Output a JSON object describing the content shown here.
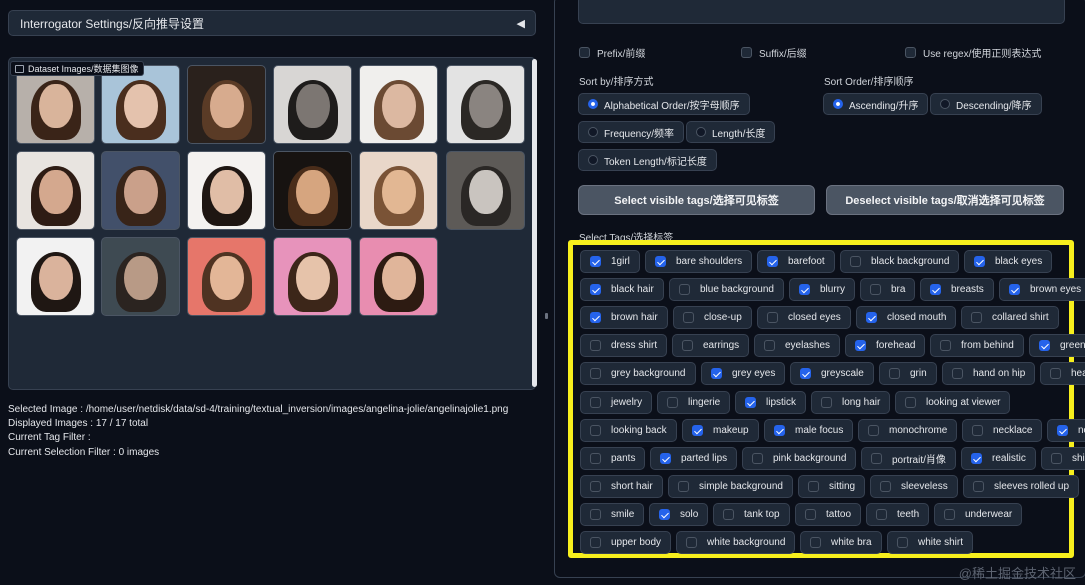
{
  "accordion": {
    "title": "Interrogator Settings/反向推导设置",
    "arrow": "◀"
  },
  "gallery": {
    "label": "Dataset Images/数据集图像",
    "thumbnails": [
      {
        "bg": "#b7b0aa",
        "skin": "#d9b49b",
        "hair": "#3a2418"
      },
      {
        "bg": "#a9c4d9",
        "skin": "#e4c2ad",
        "hair": "#4a2e1e"
      },
      {
        "bg": "#2a211c",
        "skin": "#d7ab8e",
        "hair": "#5a3b26"
      },
      {
        "bg": "#d8d6d4",
        "skin": "#7c7672",
        "hair": "#1e1c1b"
      },
      {
        "bg": "#f0efed",
        "skin": "#dcb8a1",
        "hair": "#6b4a33"
      },
      {
        "bg": "#e3e3e3",
        "skin": "#8a8480",
        "hair": "#2b2825"
      },
      {
        "bg": "#e8e4e0",
        "skin": "#d4a88e",
        "hair": "#2e1c14"
      },
      {
        "bg": "#42506a",
        "skin": "#caa08a",
        "hair": "#382418"
      },
      {
        "bg": "#f4f2f0",
        "skin": "#e0bda6",
        "hair": "#1e1612"
      },
      {
        "bg": "#171311",
        "skin": "#d6a57f",
        "hair": "#4a2d1a"
      },
      {
        "bg": "#e9d7c9",
        "skin": "#e2b793",
        "hair": "#7a5336"
      },
      {
        "bg": "#5d5a57",
        "skin": "#c9c4bf",
        "hair": "#2a2725"
      },
      {
        "bg": "#f2f2f2",
        "skin": "#dab39c",
        "hair": "#1f1713"
      },
      {
        "bg": "#3e4a52",
        "skin": "#b89a86",
        "hair": "#2b2420"
      },
      {
        "bg": "#e6766a",
        "skin": "#e3b697",
        "hair": "#4f3322"
      },
      {
        "bg": "#e793bb",
        "skin": "#e6c3aa",
        "hair": "#3c2619"
      },
      {
        "bg": "#e88db0",
        "skin": "#e0b59a",
        "hair": "#2d1b12"
      }
    ]
  },
  "info": {
    "selected_image": "Selected Image : /home/user/netdisk/data/sd-4/training/textual_inversion/images/angelina-jolie/angelinajolie1.png",
    "displayed": "Displayed Images : 17 / 17 total",
    "tag_filter": "Current Tag Filter :",
    "selection_filter": "Current Selection Filter : 0 images"
  },
  "filters": {
    "prefix": "Prefix/前缀",
    "suffix": "Suffix/后缀",
    "regex": "Use regex/使用正则表达式"
  },
  "sort_by": {
    "label": "Sort by/排序方式",
    "options": [
      {
        "label": "Alphabetical Order/按字母顺序",
        "selected": true
      },
      {
        "label": "Frequency/频率",
        "selected": false
      },
      {
        "label": "Length/长度",
        "selected": false
      },
      {
        "label": "Token Length/标记长度",
        "selected": false
      }
    ]
  },
  "sort_order": {
    "label": "Sort Order/排序顺序",
    "options": [
      {
        "label": "Ascending/升序",
        "selected": true
      },
      {
        "label": "Descending/降序",
        "selected": false
      }
    ]
  },
  "buttons": {
    "select_visible": "Select visible tags/选择可见标签",
    "deselect_visible": "Deselect visible tags/取消选择可见标签"
  },
  "select_tags_label": "Select Tags/选择标签",
  "tag_rows": [
    [
      [
        "1girl",
        true
      ],
      [
        "bare shoulders",
        true
      ],
      [
        "barefoot",
        true
      ],
      [
        "black background",
        false
      ],
      [
        "black eyes",
        true
      ]
    ],
    [
      [
        "black hair",
        true
      ],
      [
        "blue background",
        false
      ],
      [
        "blurry",
        true
      ],
      [
        "bra",
        false
      ],
      [
        "breasts",
        true
      ],
      [
        "brown eyes",
        true
      ]
    ],
    [
      [
        "brown hair",
        true
      ],
      [
        "close-up",
        false
      ],
      [
        "closed eyes",
        false
      ],
      [
        "closed mouth",
        true
      ],
      [
        "collared shirt",
        false
      ]
    ],
    [
      [
        "dress shirt",
        false
      ],
      [
        "earrings",
        false
      ],
      [
        "eyelashes",
        false
      ],
      [
        "forehead",
        true
      ],
      [
        "from behind",
        false
      ],
      [
        "green eyes",
        true
      ]
    ],
    [
      [
        "grey background",
        false
      ],
      [
        "grey eyes",
        true
      ],
      [
        "greyscale",
        true
      ],
      [
        "grin",
        false
      ],
      [
        "hand on hip",
        false
      ],
      [
        "head tilt",
        false
      ]
    ],
    [
      [
        "jewelry",
        false
      ],
      [
        "lingerie",
        false
      ],
      [
        "lipstick",
        true
      ],
      [
        "long hair",
        false
      ],
      [
        "looking at viewer",
        false
      ]
    ],
    [
      [
        "looking back",
        false
      ],
      [
        "makeup",
        true
      ],
      [
        "male focus",
        true
      ],
      [
        "monochrome",
        false
      ],
      [
        "necklace",
        false
      ],
      [
        "nose",
        true
      ]
    ],
    [
      [
        "pants",
        false
      ],
      [
        "parted lips",
        true
      ],
      [
        "pink background",
        false
      ],
      [
        "portrait/肖像",
        false
      ],
      [
        "realistic",
        true
      ],
      [
        "shirt",
        false
      ]
    ],
    [
      [
        "short hair",
        false
      ],
      [
        "simple background",
        false
      ],
      [
        "sitting",
        false
      ],
      [
        "sleeveless",
        false
      ],
      [
        "sleeves rolled up",
        false
      ]
    ],
    [
      [
        "smile",
        false
      ],
      [
        "solo",
        true
      ],
      [
        "tank top",
        false
      ],
      [
        "tattoo",
        false
      ],
      [
        "teeth",
        false
      ],
      [
        "underwear",
        false
      ]
    ],
    [
      [
        "upper body",
        false
      ],
      [
        "white background",
        false
      ],
      [
        "white bra",
        false
      ],
      [
        "white shirt",
        false
      ]
    ]
  ],
  "watermark": "@稀土掘金技术社区",
  "colors": {
    "accent": "#2563eb",
    "highlight_box": "#f7ef1d",
    "panel": "#1f2937",
    "background": "#0b0f19"
  }
}
